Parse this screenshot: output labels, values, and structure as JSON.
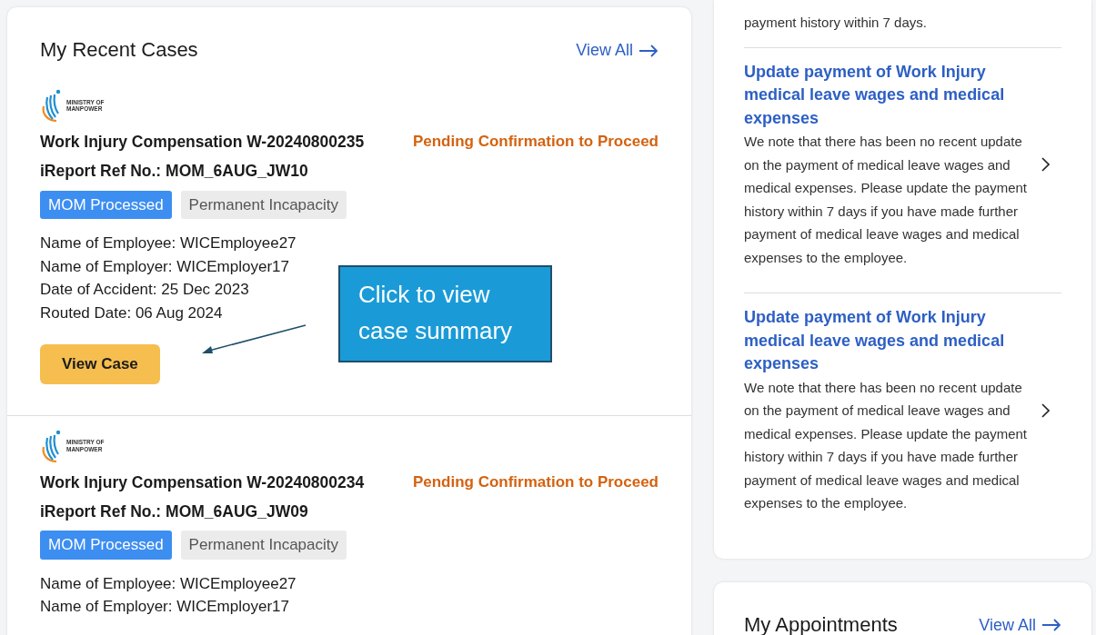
{
  "recent_cases": {
    "title": "My Recent Cases",
    "view_all": "View All",
    "cases": [
      {
        "logo_text": [
          "MINISTRY OF",
          "MANPOWER"
        ],
        "title": "Work Injury Compensation W-20240800235",
        "status": "Pending Confirmation to Proceed",
        "ref": "iReport Ref No.: MOM_6AUG_JW10",
        "tags": [
          {
            "label": "MOM Processed",
            "kind": "primary"
          },
          {
            "label": "Permanent Incapacity",
            "kind": "secondary"
          }
        ],
        "details": [
          "Name of Employee: WICEmployee27",
          "Name of Employer: WICEmployer17",
          "Date of Accident: 25 Dec 2023",
          "Routed Date: 06 Aug 2024"
        ],
        "button": "View Case"
      },
      {
        "logo_text": [
          "MINISTRY OF",
          "MANPOWER"
        ],
        "title": "Work Injury Compensation W-20240800234",
        "status": "Pending Confirmation to Proceed",
        "ref": "iReport Ref No.: MOM_6AUG_JW09",
        "tags": [
          {
            "label": "MOM Processed",
            "kind": "primary"
          },
          {
            "label": "Permanent Incapacity",
            "kind": "secondary"
          }
        ],
        "details": [
          "Name of Employee: WICEmployee27",
          "Name of Employer: WICEmployer17"
        ]
      }
    ]
  },
  "callout": {
    "text": "Click to view case summary"
  },
  "tasks": {
    "items": [
      {
        "description": "payment history within 7 days."
      },
      {
        "title": "Update payment of Work Injury medical leave wages and medical expenses",
        "description": "We note that there has been no recent update on the payment of medical leave wages and medical expenses. Please update the payment history within 7 days if you have made further payment of medical leave wages and medical expenses to the employee."
      },
      {
        "title": "Update payment of Work Injury medical leave wages and medical expenses",
        "description": "We note that there has been no recent update on the payment of medical leave wages and medical expenses. Please update the payment history within 7 days if you have made further payment of medical leave wages and medical expenses to the employee."
      }
    ]
  },
  "appointments": {
    "title": "My Appointments",
    "view_all": "View All"
  }
}
